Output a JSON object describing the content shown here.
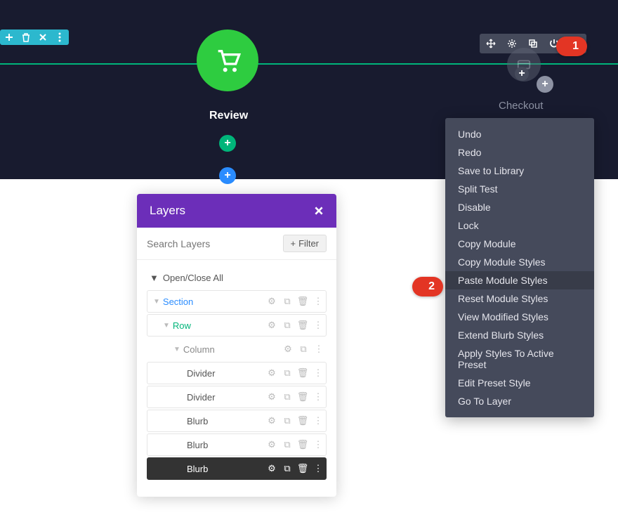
{
  "topLeft": {
    "items": [
      "add",
      "trash",
      "close",
      "more"
    ]
  },
  "topRight": {
    "items": [
      "move",
      "settings",
      "duplicate",
      "power",
      "more"
    ]
  },
  "callouts": {
    "one": "1",
    "two": "2"
  },
  "blurbs": {
    "review": "Review",
    "checkout": "Checkout"
  },
  "layers": {
    "title": "Layers",
    "searchPlaceholder": "Search Layers",
    "filterLabel": "Filter",
    "openAll": "Open/Close All",
    "section": "Section",
    "row": "Row",
    "column": "Column",
    "items": [
      "Divider",
      "Divider",
      "Blurb",
      "Blurb",
      "Blurb"
    ]
  },
  "contextMenu": {
    "items": [
      "Undo",
      "Redo",
      "Save to Library",
      "Split Test",
      "Disable",
      "Lock",
      "Copy Module",
      "Copy Module Styles",
      "Paste Module Styles",
      "Reset Module Styles",
      "View Modified Styles",
      "Extend Blurb Styles",
      "Apply Styles To Active Preset",
      "Edit Preset Style",
      "Go To Layer"
    ],
    "highlightIndex": 8
  }
}
